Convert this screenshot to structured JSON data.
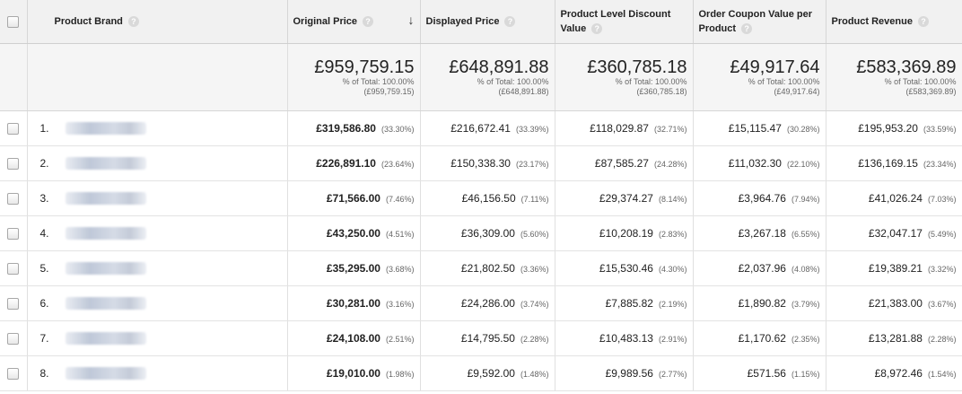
{
  "headers": {
    "brand": "Product Brand",
    "original_price": "Original Price",
    "displayed_price": "Displayed Price",
    "product_level_discount": "Product Level Discount Value",
    "order_coupon": "Order Coupon Value per Product",
    "product_revenue": "Product Revenue",
    "help_glyph": "?",
    "sort_glyph": "↓"
  },
  "totals": [
    {
      "value": "£959,759.15",
      "pct": "% of Total: 100.00%",
      "abs": "(£959,759.15)"
    },
    {
      "value": "£648,891.88",
      "pct": "% of Total: 100.00%",
      "abs": "(£648,891.88)"
    },
    {
      "value": "£360,785.18",
      "pct": "% of Total: 100.00%",
      "abs": "(£360,785.18)"
    },
    {
      "value": "£49,917.64",
      "pct": "% of Total: 100.00%",
      "abs": "(£49,917.64)"
    },
    {
      "value": "£583,369.89",
      "pct": "% of Total: 100.00%",
      "abs": "(£583,369.89)"
    }
  ],
  "rows": [
    {
      "num": "1.",
      "original": "£319,586.80",
      "original_pct": "(33.30%)",
      "displayed": "£216,672.41",
      "displayed_pct": "(33.39%)",
      "discount": "£118,029.87",
      "discount_pct": "(32.71%)",
      "coupon": "£15,115.47",
      "coupon_pct": "(30.28%)",
      "revenue": "£195,953.20",
      "revenue_pct": "(33.59%)"
    },
    {
      "num": "2.",
      "original": "£226,891.10",
      "original_pct": "(23.64%)",
      "displayed": "£150,338.30",
      "displayed_pct": "(23.17%)",
      "discount": "£87,585.27",
      "discount_pct": "(24.28%)",
      "coupon": "£11,032.30",
      "coupon_pct": "(22.10%)",
      "revenue": "£136,169.15",
      "revenue_pct": "(23.34%)"
    },
    {
      "num": "3.",
      "original": "£71,566.00",
      "original_pct": "(7.46%)",
      "displayed": "£46,156.50",
      "displayed_pct": "(7.11%)",
      "discount": "£29,374.27",
      "discount_pct": "(8.14%)",
      "coupon": "£3,964.76",
      "coupon_pct": "(7.94%)",
      "revenue": "£41,026.24",
      "revenue_pct": "(7.03%)"
    },
    {
      "num": "4.",
      "original": "£43,250.00",
      "original_pct": "(4.51%)",
      "displayed": "£36,309.00",
      "displayed_pct": "(5.60%)",
      "discount": "£10,208.19",
      "discount_pct": "(2.83%)",
      "coupon": "£3,267.18",
      "coupon_pct": "(6.55%)",
      "revenue": "£32,047.17",
      "revenue_pct": "(5.49%)"
    },
    {
      "num": "5.",
      "original": "£35,295.00",
      "original_pct": "(3.68%)",
      "displayed": "£21,802.50",
      "displayed_pct": "(3.36%)",
      "discount": "£15,530.46",
      "discount_pct": "(4.30%)",
      "coupon": "£2,037.96",
      "coupon_pct": "(4.08%)",
      "revenue": "£19,389.21",
      "revenue_pct": "(3.32%)"
    },
    {
      "num": "6.",
      "original": "£30,281.00",
      "original_pct": "(3.16%)",
      "displayed": "£24,286.00",
      "displayed_pct": "(3.74%)",
      "discount": "£7,885.82",
      "discount_pct": "(2.19%)",
      "coupon": "£1,890.82",
      "coupon_pct": "(3.79%)",
      "revenue": "£21,383.00",
      "revenue_pct": "(3.67%)"
    },
    {
      "num": "7.",
      "original": "£24,108.00",
      "original_pct": "(2.51%)",
      "displayed": "£14,795.50",
      "displayed_pct": "(2.28%)",
      "discount": "£10,483.13",
      "discount_pct": "(2.91%)",
      "coupon": "£1,170.62",
      "coupon_pct": "(2.35%)",
      "revenue": "£13,281.88",
      "revenue_pct": "(2.28%)"
    },
    {
      "num": "8.",
      "original": "£19,010.00",
      "original_pct": "(1.98%)",
      "displayed": "£9,592.00",
      "displayed_pct": "(1.48%)",
      "discount": "£9,989.56",
      "discount_pct": "(2.77%)",
      "coupon": "£571.56",
      "coupon_pct": "(1.15%)",
      "revenue": "£8,972.46",
      "revenue_pct": "(1.54%)"
    }
  ]
}
